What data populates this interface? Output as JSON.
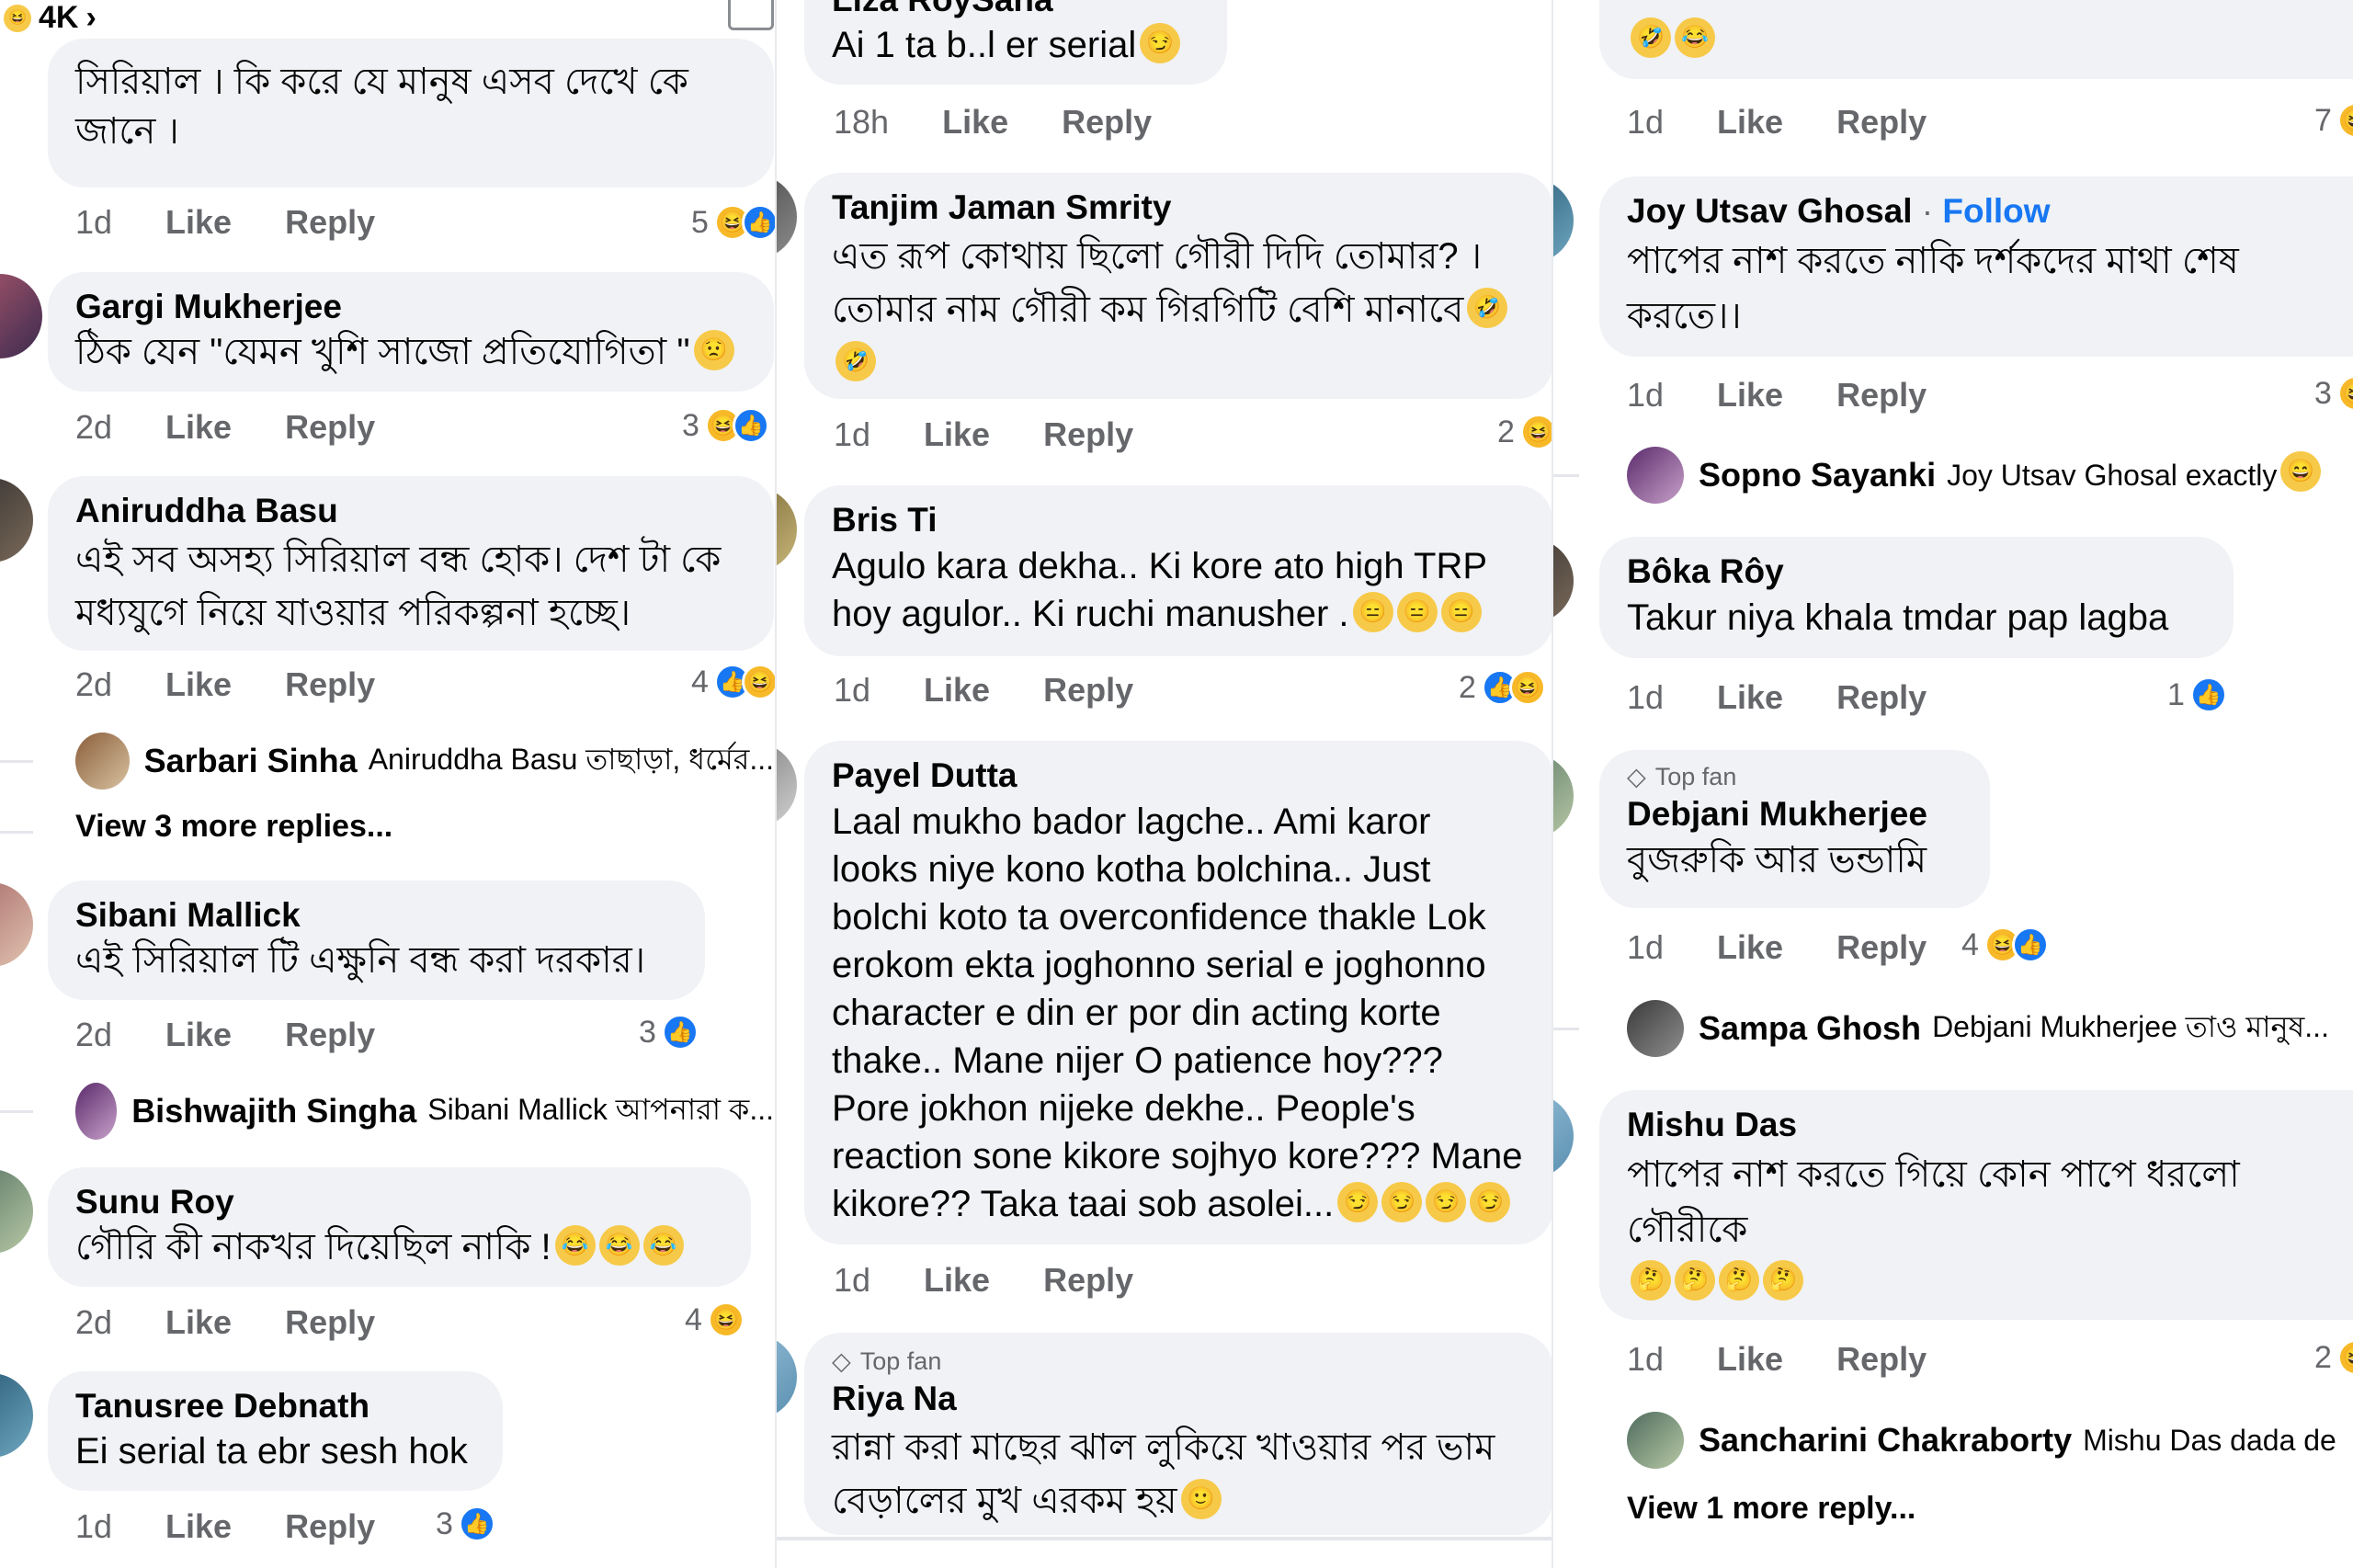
{
  "col1": {
    "top_count": "4K",
    "c0": {
      "text": "সিরিয়াল । কি করে যে মানুষ এসব দেখে কে জানে ।",
      "time": "1d",
      "like": "Like",
      "reply": "Reply",
      "count": "5"
    },
    "c1": {
      "name": "Gargi Mukherjee",
      "text": "ঠিক যেন \"যেমন খুশি সাজো প্রতিযোগিতা \"",
      "time": "2d",
      "like": "Like",
      "reply": "Reply",
      "count": "3"
    },
    "c2": {
      "name": "Aniruddha Basu",
      "text": "এই সব অসহ্য সিরিয়াল বন্ধ হোক। দেশ টা কে মধ্যযুগে নিয়ে যাওয়ার পরিকল্পনা হচ্ছে।",
      "time": "2d",
      "like": "Like",
      "reply": "Reply",
      "count": "4"
    },
    "r2": {
      "name": "Sarbari Sinha",
      "text": "Aniruddha Basu তাছাড়া, ধর্মের..."
    },
    "more2": "View 3 more replies...",
    "c3": {
      "name": "Sibani Mallick",
      "text": "এই সিরিয়াল টি এক্ষুনি বন্ধ করা দরকার।",
      "time": "2d",
      "like": "Like",
      "reply": "Reply",
      "count": "3"
    },
    "r3": {
      "name": "Bishwajith Singha",
      "text": "Sibani Mallick আপনারা ক..."
    },
    "c4": {
      "name": "Sunu Roy",
      "text": "গৌরি কী নাকখর দিয়েছিল নাকি !",
      "time": "2d",
      "like": "Like",
      "reply": "Reply",
      "count": "4"
    },
    "c5": {
      "name": "Tanusree Debnath",
      "text": "Ei serial ta ebr sesh hok",
      "time": "1d",
      "like": "Like",
      "reply": "Reply",
      "count": "3"
    }
  },
  "col2": {
    "c0": {
      "name": "Liza RoySaha",
      "text": "Ai 1 ta b..l er serial",
      "time": "18h",
      "like": "Like",
      "reply": "Reply"
    },
    "c1": {
      "name": "Tanjim Jaman Smrity",
      "text": "এত রূপ কোথায় ছিলো গৌরী দিদি তোমার? । তোমার নাম গৌরী কম গিরগিটি বেশি মানাবে",
      "time": "1d",
      "like": "Like",
      "reply": "Reply",
      "count": "2"
    },
    "c2": {
      "name": "Bris Ti",
      "text": "Agulo  kara dekha.. Ki kore ato high TRP hoy agulor..  Ki ruchi  manusher .",
      "time": "1d",
      "like": "Like",
      "reply": "Reply",
      "count": "2"
    },
    "c3": {
      "name": "Payel Dutta",
      "text": "Laal mukho bador lagche.. Ami karor looks niye kono kotha bolchina.. Just bolchi koto ta overconfidence thakle Lok erokom ekta joghonno serial e joghonno character e din er por din acting korte thake.. Mane nijer O patience hoy??? Pore jokhon nijeke dekhe.. People's reaction sone kikore sojhyo kore??? Mane kikore?? Taka taai sob asolei...",
      "time": "1d",
      "like": "Like",
      "reply": "Reply"
    },
    "c4": {
      "badge": "Top fan",
      "name": "Riya Na",
      "text": "রান্না করা মাছের ঝাল লুকিয়ে খাওয়ার পর ভাম বেড়ালের মুখ এরকম হয়"
    }
  },
  "col3": {
    "c0": {
      "time": "1d",
      "like": "Like",
      "reply": "Reply",
      "count": "7"
    },
    "c1": {
      "name": "Joy Utsav Ghosal",
      "follow": "Follow",
      "sep": "·",
      "text": "পাপের নাশ করতে নাকি দর্শকদের মাথা শেষ করতে।।",
      "time": "1d",
      "like": "Like",
      "reply": "Reply",
      "count": "3"
    },
    "r1": {
      "name": "Sopno Sayanki",
      "text": "Joy Utsav Ghosal exactly"
    },
    "c2": {
      "name": "Bôka Rôy",
      "text": "Takur niya khala tmdar pap lagba",
      "time": "1d",
      "like": "Like",
      "reply": "Reply",
      "count": "1"
    },
    "c3": {
      "badge": "Top fan",
      "name": "Debjani Mukherjee",
      "text": "বুজরুকি আর ভন্ডামি",
      "time": "1d",
      "like": "Like",
      "reply": "Reply",
      "count": "4"
    },
    "r3": {
      "name": "Sampa Ghosh",
      "text": "Debjani Mukherjee তাও মানুষ..."
    },
    "c4": {
      "name": "Mishu Das",
      "text": "পাপের নাশ করতে গিয়ে কোন পাপে ধরলো গৌরীকে",
      "time": "1d",
      "like": "Like",
      "reply": "Reply",
      "count": "2"
    },
    "r4": {
      "name": "Sancharini Chakraborty",
      "text": "Mishu Das dada de"
    },
    "more4": "View 1 more reply..."
  },
  "icons": {
    "like": "thumbs-up-icon",
    "haha": "laughing-face-icon",
    "share": "share-icon",
    "chevron": "chevron-right-icon",
    "diamond": "diamond-icon"
  },
  "colors": {
    "like_blue": "#1877f2",
    "bubble": "#f0f2f5",
    "meta": "#65676b"
  }
}
